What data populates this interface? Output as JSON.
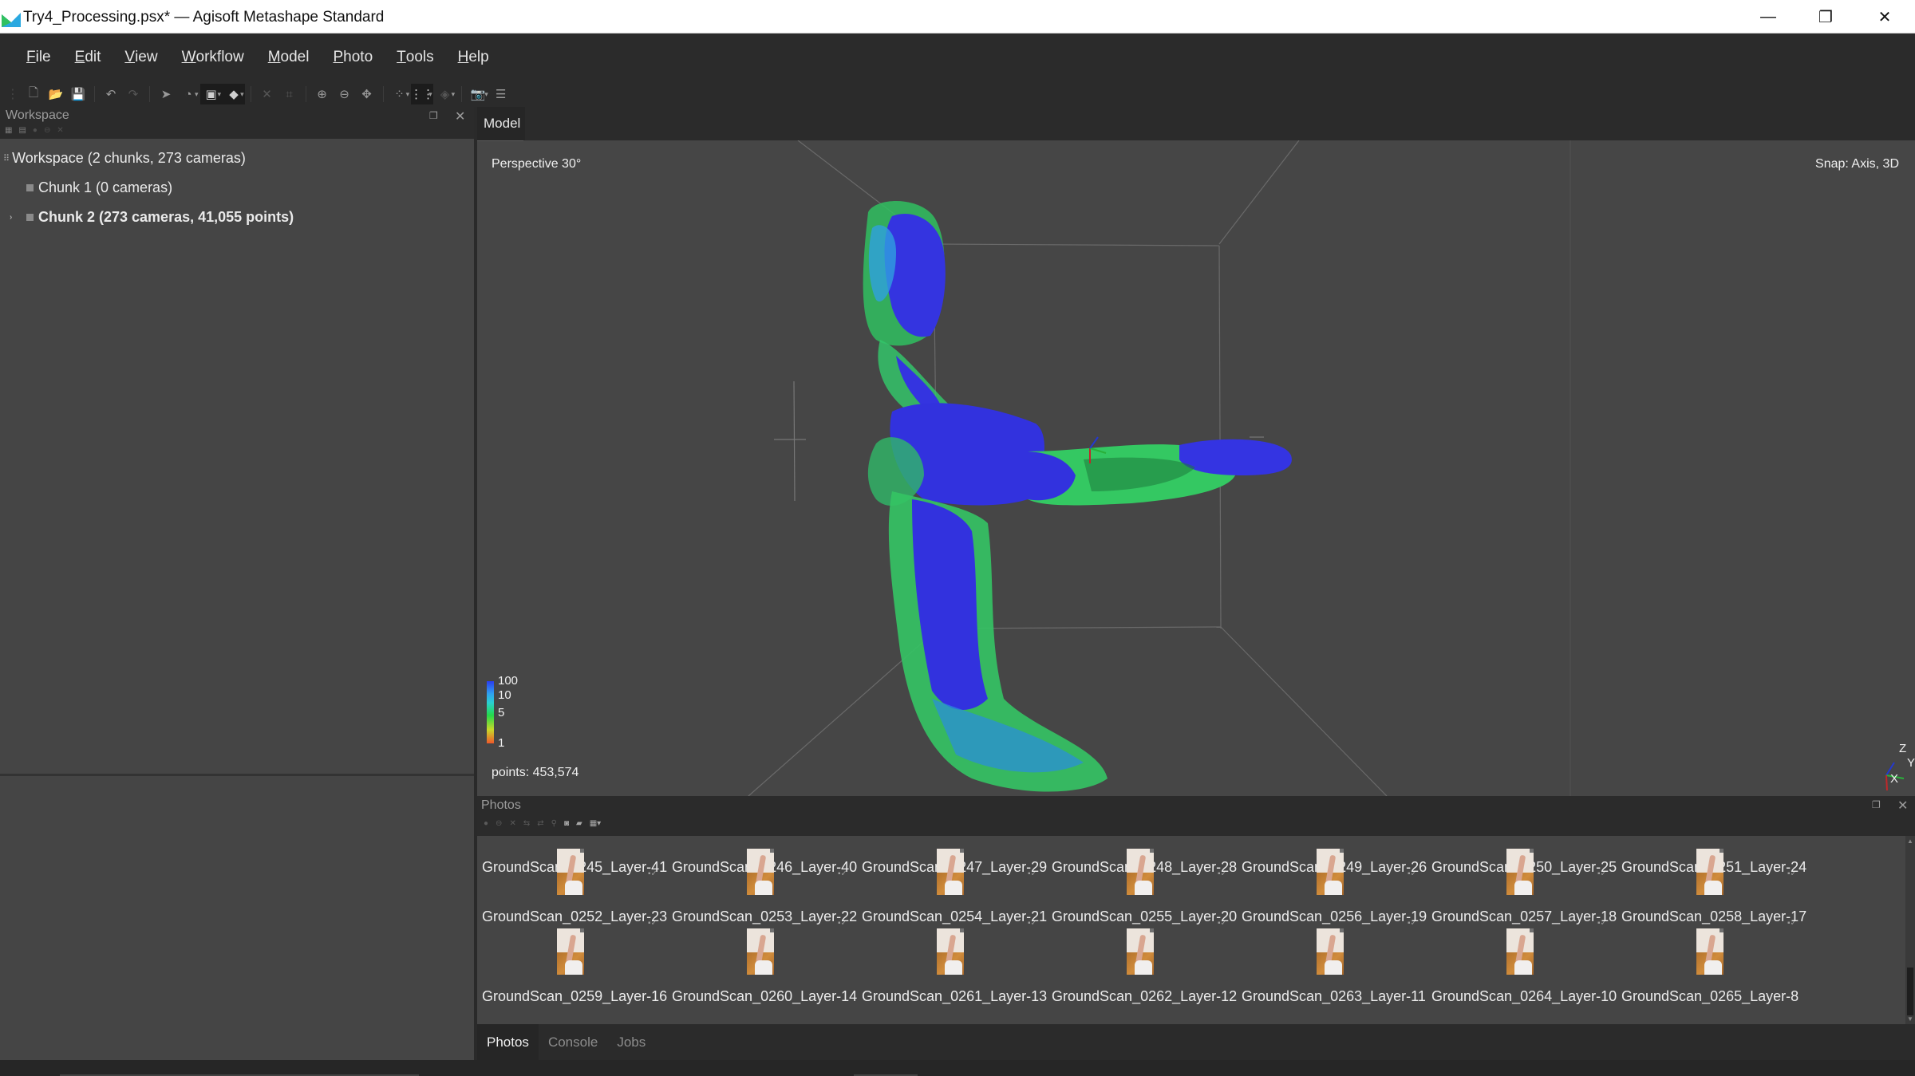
{
  "window": {
    "title": "Try4_Processing.psx* — Agisoft Metashape Standard",
    "controls": {
      "minimize": "—",
      "restore": "❐",
      "close": "✕"
    }
  },
  "menubar": {
    "items": [
      {
        "label": "File",
        "accel": "F"
      },
      {
        "label": "Edit",
        "accel": "E"
      },
      {
        "label": "View",
        "accel": "V"
      },
      {
        "label": "Workflow",
        "accel": "W"
      },
      {
        "label": "Model",
        "accel": "M"
      },
      {
        "label": "Photo",
        "accel": "P"
      },
      {
        "label": "Tools",
        "accel": "T"
      },
      {
        "label": "Help",
        "accel": "H"
      }
    ]
  },
  "toolbar": {
    "buttons": [
      {
        "name": "new-document",
        "glyph": "🗋",
        "dim": false
      },
      {
        "name": "open-folder",
        "glyph": "📂",
        "dim": false
      },
      {
        "name": "save",
        "glyph": "💾",
        "dim": false
      },
      {
        "name": "undo",
        "glyph": "↶",
        "dim": false
      },
      {
        "name": "redo",
        "glyph": "↷",
        "dim": true
      },
      {
        "name": "navigation-pointer",
        "glyph": "➤",
        "dim": false
      },
      {
        "name": "rotate-object",
        "glyph": "◔",
        "dim": false,
        "dropdown": true
      },
      {
        "name": "resize-region",
        "glyph": "▣",
        "dim": false,
        "dropdown": true,
        "active": true
      },
      {
        "name": "selection-tool",
        "glyph": "◆",
        "dim": false,
        "dropdown": true,
        "active": true
      },
      {
        "name": "delete-selection",
        "glyph": "✕",
        "dim": true
      },
      {
        "name": "crop-selection",
        "glyph": "⌗",
        "dim": true
      },
      {
        "name": "zoom-in",
        "glyph": "⊕",
        "dim": false
      },
      {
        "name": "zoom-out",
        "glyph": "⊖",
        "dim": false
      },
      {
        "name": "reset-view",
        "glyph": "✥",
        "dim": false
      },
      {
        "name": "point-cloud-view",
        "glyph": "⁘",
        "dim": false,
        "dropdown": true
      },
      {
        "name": "dense-cloud-view",
        "glyph": "⋮⋮",
        "dim": false,
        "dropdown": true,
        "active": true
      },
      {
        "name": "model-view",
        "glyph": "◈",
        "dim": true,
        "dropdown": true
      },
      {
        "name": "show-cameras",
        "glyph": "📷",
        "dim": false,
        "dropdown": true
      },
      {
        "name": "show-layers",
        "glyph": "☰",
        "dim": false
      }
    ]
  },
  "workspace": {
    "title": "Workspace",
    "tree": [
      {
        "label": "Workspace (2 chunks, 273 cameras)",
        "level": 0,
        "bold": false
      },
      {
        "label": "Chunk 1 (0 cameras)",
        "level": 1,
        "bold": false
      },
      {
        "label": "Chunk 2 (273 cameras, 41,055 points)",
        "level": 1,
        "bold": true,
        "expandable": true
      }
    ]
  },
  "model": {
    "tab_label": "Model",
    "projection": "Perspective 30°",
    "snap": "Snap: Axis, 3D",
    "points": "points: 453,574",
    "legend": {
      "labels": [
        "100",
        "10",
        "5",
        "1"
      ]
    },
    "axes": {
      "z": "Z",
      "y": "Y",
      "x": "X"
    },
    "colors": {
      "axis_x": "#c0282a",
      "axis_y": "#2ab03a",
      "axis_z": "#2438d0",
      "cloud_primary": "#3030e0",
      "cloud_secondary": "#34d060"
    }
  },
  "photos": {
    "title": "Photos",
    "rows": [
      [
        "GroundScan_0245_Layer-41",
        "GroundScan_0246_Layer-40",
        "GroundScan_0247_Layer-29",
        "GroundScan_0248_Layer-28",
        "GroundScan_0249_Layer-26",
        "GroundScan_0250_Layer-25",
        "GroundScan_0251_Layer-24"
      ],
      [
        "GroundScan_0252_Layer-23",
        "GroundScan_0253_Layer-22",
        "GroundScan_0254_Layer-21",
        "GroundScan_0255_Layer-20",
        "GroundScan_0256_Layer-19",
        "GroundScan_0257_Layer-18",
        "GroundScan_0258_Layer-17"
      ],
      [
        "GroundScan_0259_Layer-16",
        "GroundScan_0260_Layer-14",
        "GroundScan_0261_Layer-13",
        "GroundScan_0262_Layer-12",
        "GroundScan_0263_Layer-11",
        "GroundScan_0264_Layer-10",
        "GroundScan_0265_Layer-8"
      ]
    ],
    "status_glyph": "▪✓"
  },
  "bottom_tabs": [
    {
      "label": "Photos",
      "active": true
    },
    {
      "label": "Console",
      "active": false
    },
    {
      "label": "Jobs",
      "active": false
    }
  ]
}
